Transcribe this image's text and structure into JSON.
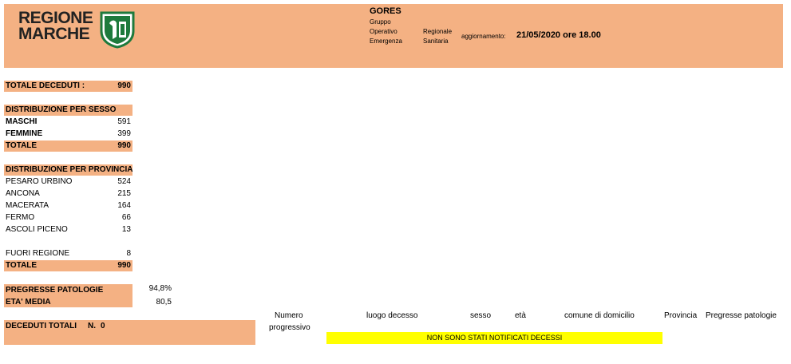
{
  "header": {
    "logo_line1": "REGIONE",
    "logo_line2": "MARCHE",
    "title": "GORES",
    "org_gruppo": "Gruppo",
    "org_operativo": "Operativo",
    "org_emergenza": "Emergenza",
    "org_regionale": "Regionale",
    "org_sanitaria": "Sanitaria",
    "update_label": "aggiornamento:",
    "update_value": "21/05/2020 ore 18.00"
  },
  "totale_deceduti": {
    "label": "TOTALE DECEDUTI :",
    "value": "990"
  },
  "sesso": {
    "title": "DISTRIBUZIONE PER SESSO",
    "rows": [
      {
        "label": "MASCHI",
        "value": "591"
      },
      {
        "label": "FEMMINE",
        "value": "399"
      }
    ],
    "total": {
      "label": "TOTALE",
      "value": "990"
    }
  },
  "provincia": {
    "title": "DISTRIBUZIONE PER PROVINCIA",
    "rows": [
      {
        "label": "PESARO URBINO",
        "value": "524"
      },
      {
        "label": "ANCONA",
        "value": "215"
      },
      {
        "label": "MACERATA",
        "value": "164"
      },
      {
        "label": "FERMO",
        "value": "66"
      },
      {
        "label": "ASCOLI PICENO",
        "value": "13"
      }
    ],
    "fuori": {
      "label": "FUORI REGIONE",
      "value": "8"
    },
    "total": {
      "label": "TOTALE",
      "value": "990"
    }
  },
  "stats": {
    "patologie_label": "PREGRESSE PATOLOGIE",
    "patologie_value": "94,8%",
    "eta_label": "ETA' MEDIA",
    "eta_value": "80,5"
  },
  "deceduti_totali": {
    "label": "DECEDUTI TOTALI",
    "n_label": "N.",
    "n_value": "0"
  },
  "table": {
    "columns": [
      "Numero progressivo",
      "luogo decesso",
      "sesso",
      "età",
      "comune di domicilio",
      "Provincia",
      "Pregresse patologie"
    ],
    "col_numero_line1": "Numero",
    "col_numero_line2": "progressivo",
    "empty_message": "NON SONO STATI NOTIFICATI DECESSI"
  },
  "colors": {
    "salmon": "#f4b183",
    "yellow": "#ffff00",
    "logo_green": "#1e7a3c"
  }
}
